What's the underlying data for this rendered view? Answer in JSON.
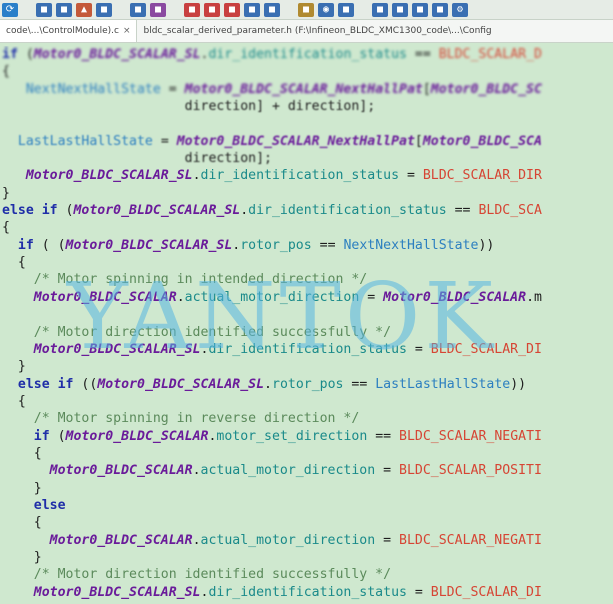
{
  "toolbar": {
    "icons": [
      {
        "name": "refresh-icon",
        "color": "#2a7fc9",
        "glyph": "⟳"
      },
      {
        "name": "save-icon",
        "color": "#3a6fb2",
        "glyph": "■"
      },
      {
        "name": "save-all-icon",
        "color": "#3a6fb2",
        "glyph": "■"
      },
      {
        "name": "build-icon",
        "color": "#c45a3a",
        "glyph": "▲"
      },
      {
        "name": "rebuild-icon",
        "color": "#3a6fb2",
        "glyph": "■"
      },
      {
        "name": "batch-icon",
        "color": "#3a6fb2",
        "glyph": "■"
      },
      {
        "name": "stop-icon",
        "color": "#8a4aa0",
        "glyph": "■"
      },
      {
        "name": "download-icon",
        "color": "#c84040",
        "glyph": "■"
      },
      {
        "name": "debug-icon",
        "color": "#c84040",
        "glyph": "■"
      },
      {
        "name": "breakpoint-icon",
        "color": "#c84040",
        "glyph": "■"
      },
      {
        "name": "step-icon",
        "color": "#3a6fb2",
        "glyph": "■"
      },
      {
        "name": "options-icon",
        "color": "#3a6fb2",
        "glyph": "■"
      },
      {
        "name": "manage-icon",
        "color": "#b08a30",
        "glyph": "■"
      },
      {
        "name": "find-icon",
        "color": "#3a6fb2",
        "glyph": "◉"
      },
      {
        "name": "window-icon",
        "color": "#3a6fb2",
        "glyph": "■"
      },
      {
        "name": "layout-icon",
        "color": "#3a6fb2",
        "glyph": "■"
      },
      {
        "name": "pack-icon",
        "color": "#3a6fb2",
        "glyph": "■"
      },
      {
        "name": "view-icon",
        "color": "#3a6fb2",
        "glyph": "■"
      },
      {
        "name": "help-icon",
        "color": "#3a6fb2",
        "glyph": "■"
      },
      {
        "name": "gear-icon",
        "color": "#3a6fb2",
        "glyph": "⚙"
      }
    ]
  },
  "tabs": [
    {
      "label": "code\\...\\ControlModule).c",
      "close": "×",
      "active": true
    },
    {
      "label": "bldc_scalar_derived_parameter.h (F:\\Infineon_BLDC_XMC1300_code\\...\\Config",
      "close": "",
      "active": false
    }
  ],
  "code_lines": [
    {
      "indent": "",
      "blur": "blur1",
      "segments": [
        {
          "c": "kw",
          "t": "if "
        },
        {
          "c": "pl",
          "t": "("
        },
        {
          "c": "mac",
          "t": "Motor0_BLDC_SCALAR_SL"
        },
        {
          "c": "pl",
          "t": "."
        },
        {
          "c": "fld",
          "t": "dir_identification_status"
        },
        {
          "c": "pl",
          "t": " == "
        },
        {
          "c": "con",
          "t": "BLDC_SCALAR_D"
        }
      ]
    },
    {
      "indent": "",
      "blur": "blur1",
      "segments": [
        {
          "c": "pl",
          "t": "{"
        }
      ]
    },
    {
      "indent": "   ",
      "blur": "blur1",
      "segments": [
        {
          "c": "loc",
          "t": "NextNextHallState"
        },
        {
          "c": "pl",
          "t": " = "
        },
        {
          "c": "mac",
          "t": "Motor0_BLDC_SCALAR_NextHallPat"
        },
        {
          "c": "pl",
          "t": "["
        },
        {
          "c": "mac",
          "t": "Motor0_BLDC_SC"
        }
      ]
    },
    {
      "indent": "                       ",
      "blur": "blur2",
      "segments": [
        {
          "c": "pl",
          "t": "direction] + direction];"
        }
      ]
    },
    {
      "indent": "",
      "blur": "",
      "segments": [
        {
          "c": "pl",
          "t": " "
        }
      ]
    },
    {
      "indent": "  ",
      "blur": "blur2",
      "segments": [
        {
          "c": "loc",
          "t": "LastLastHallState"
        },
        {
          "c": "pl",
          "t": " = "
        },
        {
          "c": "mac",
          "t": "Motor0_BLDC_SCALAR_NextHallPat"
        },
        {
          "c": "pl",
          "t": "["
        },
        {
          "c": "mac",
          "t": "Motor0_BLDC_SCA"
        }
      ]
    },
    {
      "indent": "                       ",
      "blur": "blur2",
      "segments": [
        {
          "c": "pl",
          "t": "direction];"
        }
      ]
    },
    {
      "indent": "   ",
      "blur": "",
      "segments": [
        {
          "c": "mac",
          "t": "Motor0_BLDC_SCALAR_SL"
        },
        {
          "c": "pl",
          "t": "."
        },
        {
          "c": "fld",
          "t": "dir_identification_status"
        },
        {
          "c": "pl",
          "t": " = "
        },
        {
          "c": "con",
          "t": "BLDC_SCALAR_DIR"
        }
      ]
    },
    {
      "indent": "",
      "blur": "",
      "segments": [
        {
          "c": "pl",
          "t": "}"
        }
      ]
    },
    {
      "indent": "",
      "blur": "",
      "segments": [
        {
          "c": "kw",
          "t": "else if "
        },
        {
          "c": "pl",
          "t": "("
        },
        {
          "c": "mac",
          "t": "Motor0_BLDC_SCALAR_SL"
        },
        {
          "c": "pl",
          "t": "."
        },
        {
          "c": "fld",
          "t": "dir_identification_status"
        },
        {
          "c": "pl",
          "t": " == "
        },
        {
          "c": "con",
          "t": "BLDC_SCA"
        }
      ]
    },
    {
      "indent": "",
      "blur": "",
      "segments": [
        {
          "c": "pl",
          "t": "{"
        }
      ]
    },
    {
      "indent": "  ",
      "blur": "",
      "segments": [
        {
          "c": "kw",
          "t": "if "
        },
        {
          "c": "pl",
          "t": "( ("
        },
        {
          "c": "mac",
          "t": "Motor0_BLDC_SCALAR_SL"
        },
        {
          "c": "pl",
          "t": "."
        },
        {
          "c": "fld",
          "t": "rotor_pos"
        },
        {
          "c": "pl",
          "t": " == "
        },
        {
          "c": "loc",
          "t": "NextNextHallState"
        },
        {
          "c": "pl",
          "t": "))"
        }
      ]
    },
    {
      "indent": "  ",
      "blur": "",
      "segments": [
        {
          "c": "pl",
          "t": "{"
        }
      ]
    },
    {
      "indent": "    ",
      "blur": "",
      "segments": [
        {
          "c": "cmt",
          "t": "/* Motor spinning in intended direction */"
        }
      ]
    },
    {
      "indent": "    ",
      "blur": "",
      "segments": [
        {
          "c": "mac",
          "t": "Motor0_BLDC_SCALAR"
        },
        {
          "c": "pl",
          "t": "."
        },
        {
          "c": "fld",
          "t": "actual_motor_direction"
        },
        {
          "c": "pl",
          "t": " = "
        },
        {
          "c": "mac",
          "t": "Motor0_BLDC_SCALAR"
        },
        {
          "c": "pl",
          "t": ".m"
        }
      ]
    },
    {
      "indent": "",
      "blur": "",
      "segments": [
        {
          "c": "pl",
          "t": " "
        }
      ]
    },
    {
      "indent": "    ",
      "blur": "",
      "segments": [
        {
          "c": "cmt",
          "t": "/* Motor direction identified successfully */"
        }
      ]
    },
    {
      "indent": "    ",
      "blur": "",
      "segments": [
        {
          "c": "mac",
          "t": "Motor0_BLDC_SCALAR_SL"
        },
        {
          "c": "pl",
          "t": "."
        },
        {
          "c": "fld",
          "t": "dir_identification_status"
        },
        {
          "c": "pl",
          "t": " = "
        },
        {
          "c": "con",
          "t": "BLDC_SCALAR_DI"
        }
      ]
    },
    {
      "indent": "  ",
      "blur": "",
      "segments": [
        {
          "c": "pl",
          "t": "}"
        }
      ]
    },
    {
      "indent": "  ",
      "blur": "",
      "segments": [
        {
          "c": "kw",
          "t": "else if "
        },
        {
          "c": "pl",
          "t": "(("
        },
        {
          "c": "mac",
          "t": "Motor0_BLDC_SCALAR_SL"
        },
        {
          "c": "pl",
          "t": "."
        },
        {
          "c": "fld",
          "t": "rotor_pos"
        },
        {
          "c": "pl",
          "t": " == "
        },
        {
          "c": "loc",
          "t": "LastLastHallState"
        },
        {
          "c": "pl",
          "t": "))"
        }
      ]
    },
    {
      "indent": "  ",
      "blur": "",
      "segments": [
        {
          "c": "pl",
          "t": "{"
        }
      ]
    },
    {
      "indent": "    ",
      "blur": "",
      "segments": [
        {
          "c": "cmt",
          "t": "/* Motor spinning in reverse direction */"
        }
      ]
    },
    {
      "indent": "    ",
      "blur": "",
      "segments": [
        {
          "c": "kw",
          "t": "if "
        },
        {
          "c": "pl",
          "t": "("
        },
        {
          "c": "mac",
          "t": "Motor0_BLDC_SCALAR"
        },
        {
          "c": "pl",
          "t": "."
        },
        {
          "c": "fld",
          "t": "motor_set_direction"
        },
        {
          "c": "pl",
          "t": " == "
        },
        {
          "c": "con",
          "t": "BLDC_SCALAR_NEGATI"
        }
      ]
    },
    {
      "indent": "    ",
      "blur": "",
      "segments": [
        {
          "c": "pl",
          "t": "{"
        }
      ]
    },
    {
      "indent": "      ",
      "blur": "",
      "segments": [
        {
          "c": "mac",
          "t": "Motor0_BLDC_SCALAR"
        },
        {
          "c": "pl",
          "t": "."
        },
        {
          "c": "fld",
          "t": "actual_motor_direction"
        },
        {
          "c": "pl",
          "t": " = "
        },
        {
          "c": "con",
          "t": "BLDC_SCALAR_POSITI"
        }
      ]
    },
    {
      "indent": "    ",
      "blur": "",
      "segments": [
        {
          "c": "pl",
          "t": "}"
        }
      ]
    },
    {
      "indent": "    ",
      "blur": "",
      "segments": [
        {
          "c": "kw",
          "t": "else"
        }
      ]
    },
    {
      "indent": "    ",
      "blur": "",
      "segments": [
        {
          "c": "pl",
          "t": "{"
        }
      ]
    },
    {
      "indent": "      ",
      "blur": "",
      "segments": [
        {
          "c": "mac",
          "t": "Motor0_BLDC_SCALAR"
        },
        {
          "c": "pl",
          "t": "."
        },
        {
          "c": "fld",
          "t": "actual_motor_direction"
        },
        {
          "c": "pl",
          "t": " = "
        },
        {
          "c": "con",
          "t": "BLDC_SCALAR_NEGATI"
        }
      ]
    },
    {
      "indent": "    ",
      "blur": "",
      "segments": [
        {
          "c": "pl",
          "t": "}"
        }
      ]
    },
    {
      "indent": "    ",
      "blur": "",
      "segments": [
        {
          "c": "cmt",
          "t": "/* Motor direction identified successfully */"
        }
      ]
    },
    {
      "indent": "    ",
      "blur": "",
      "segments": [
        {
          "c": "mac",
          "t": "Motor0_BLDC_SCALAR_SL"
        },
        {
          "c": "pl",
          "t": "."
        },
        {
          "c": "fld",
          "t": "dir_identification_status"
        },
        {
          "c": "pl",
          "t": " = "
        },
        {
          "c": "con",
          "t": "BLDC_SCALAR_DI"
        }
      ]
    }
  ],
  "watermark": "YANTOK"
}
